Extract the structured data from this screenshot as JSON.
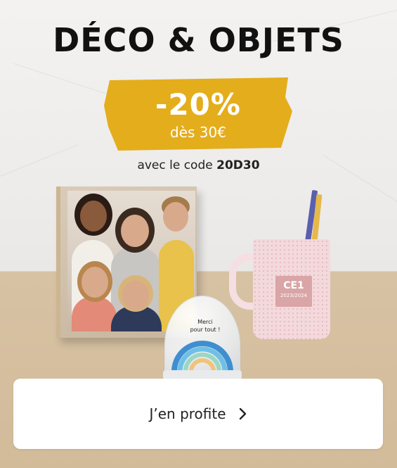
{
  "banner": {
    "title": "DÉCO & OBJETS",
    "promo": {
      "discount": "-20%",
      "condition": "dès 30€",
      "badge_color": "#e4ad1c"
    },
    "code_prefix": "avec le code",
    "code": "20D30"
  },
  "products": {
    "globe_text_line1": "Merci",
    "globe_text_line2": "pour tout !",
    "mug_label_line1": "CE1",
    "mug_label_line2": "2023/2024"
  },
  "cta": {
    "label": "J’en profite",
    "icon": "chevron-right-icon"
  }
}
